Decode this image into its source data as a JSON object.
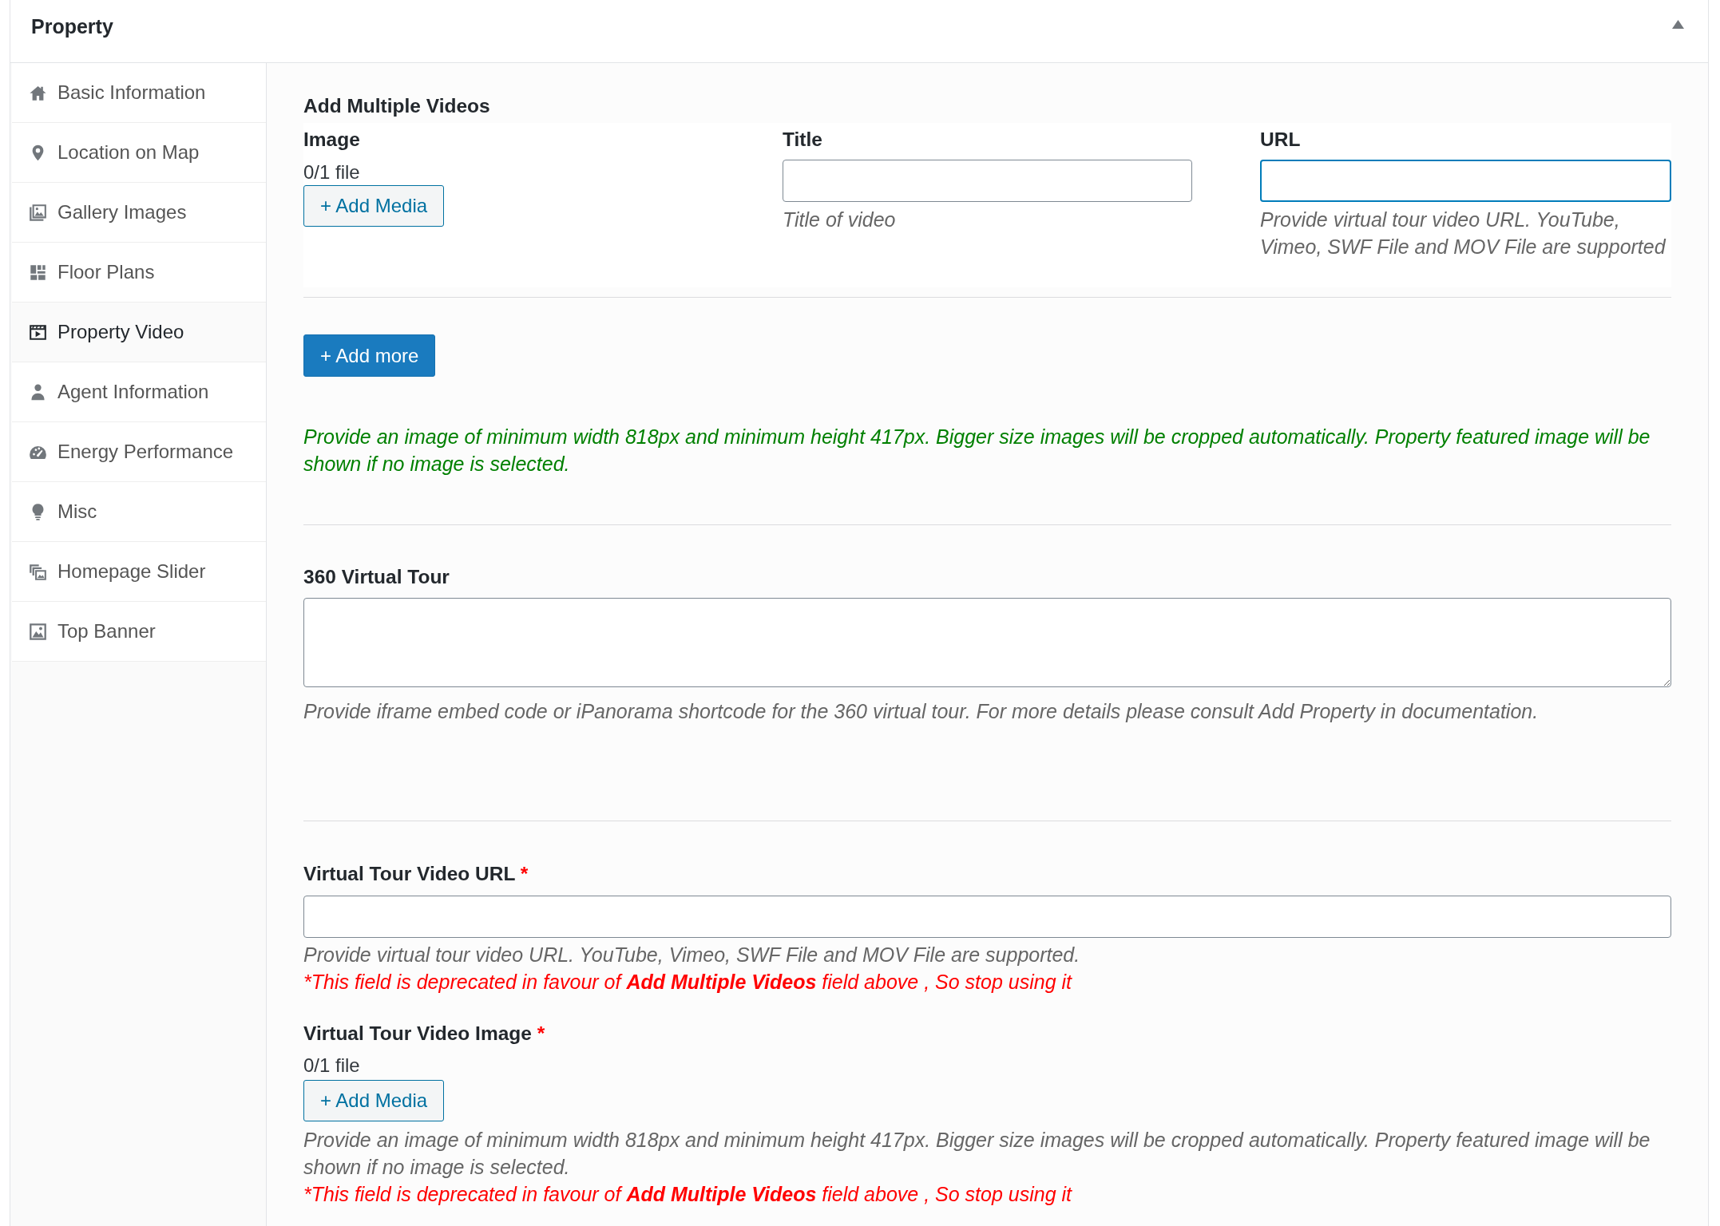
{
  "panel": {
    "title": "Property",
    "expanded": true
  },
  "sidebar": {
    "items": [
      {
        "label": "Basic Information",
        "selected": false
      },
      {
        "label": "Location on Map",
        "selected": false
      },
      {
        "label": "Gallery Images",
        "selected": false
      },
      {
        "label": "Floor Plans",
        "selected": false
      },
      {
        "label": "Property Video",
        "selected": true
      },
      {
        "label": "Agent Information",
        "selected": false
      },
      {
        "label": "Energy Performance",
        "selected": false
      },
      {
        "label": "Misc",
        "selected": false
      },
      {
        "label": "Homepage Slider",
        "selected": false
      },
      {
        "label": "Top Banner",
        "selected": false
      }
    ]
  },
  "multiple_videos": {
    "title": "Add Multiple Videos",
    "image": {
      "label": "Image",
      "count": "0/1 file",
      "button": "+ Add Media"
    },
    "title_field": {
      "label": "Title",
      "help": "Title of video",
      "focused": false
    },
    "url_field": {
      "label": "URL",
      "help": "Provide virtual tour video URL. YouTube, Vimeo, SWF File and MOV File are supported",
      "focused": true
    },
    "add_button": "+ Add more",
    "note": "Provide an image of minimum width 818px and minimum height 417px. Bigger size images will be cropped automatically. Property featured image will be shown if no image is selected."
  },
  "virtual_tour_360": {
    "label": "360 Virtual Tour",
    "help": "Provide iframe embed code or iPanorama shortcode for the 360 virtual tour. For more details please consult Add Property in documentation."
  },
  "video_url": {
    "label": "Virtual Tour Video URL",
    "required_mark": "*",
    "help": "Provide virtual tour video URL. YouTube, Vimeo, SWF File and MOV File are supported.",
    "warning": {
      "before": "*This field is deprecated in favour of",
      "bold": "Add Multiple Videos",
      "after": "field above , So stop using it"
    }
  },
  "video_image": {
    "label": "Virtual Tour Video Image",
    "required_mark": "*",
    "count": "0/1 file",
    "button": "+ Add Media",
    "help": "Provide an image of minimum width 818px and minimum height 417px. Bigger size images will be cropped automatically. Property featured image will be shown if no image is selected.",
    "warning": {
      "before": "*This field is deprecated in favour of",
      "bold": "Add Multiple Videos",
      "after": "field above , So stop using it"
    }
  }
}
